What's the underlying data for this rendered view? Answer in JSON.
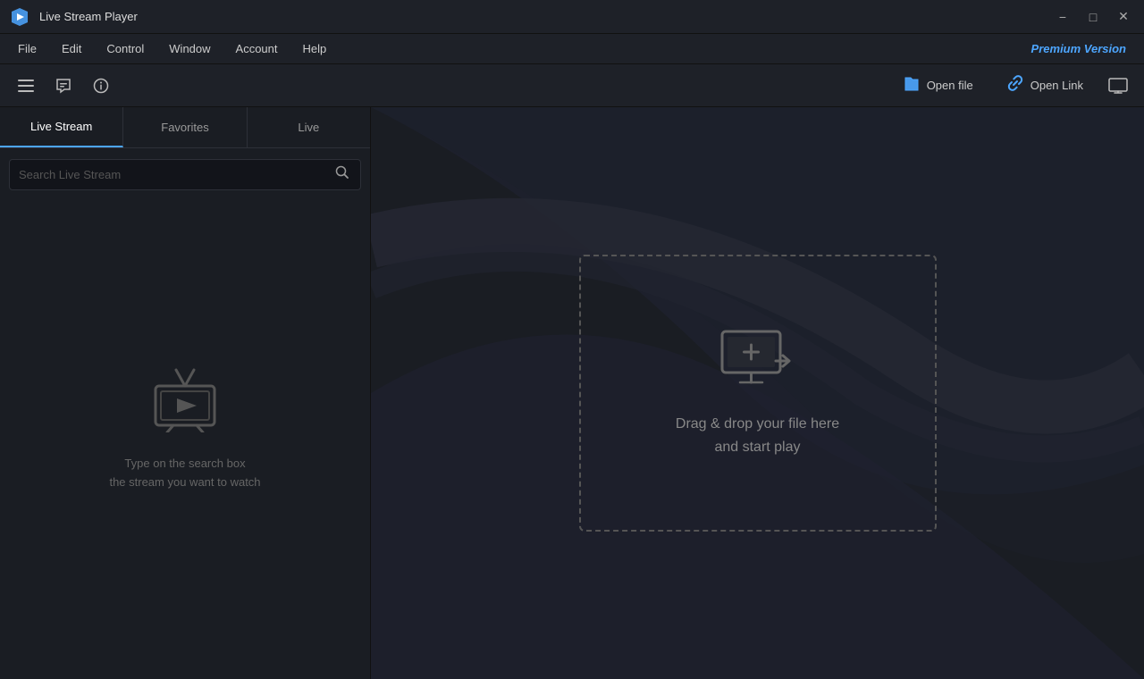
{
  "titlebar": {
    "title": "Live Stream Player",
    "minimize_label": "−",
    "maximize_label": "□",
    "close_label": "✕"
  },
  "menubar": {
    "items": [
      {
        "id": "file",
        "label": "File"
      },
      {
        "id": "edit",
        "label": "Edit"
      },
      {
        "id": "control",
        "label": "Control"
      },
      {
        "id": "window",
        "label": "Window"
      },
      {
        "id": "account",
        "label": "Account"
      },
      {
        "id": "help",
        "label": "Help"
      }
    ],
    "premium_label": "Premium Version"
  },
  "toolbar": {
    "open_file_label": "Open file",
    "open_link_label": "Open Link"
  },
  "sidebar": {
    "tabs": [
      {
        "id": "live-stream",
        "label": "Live Stream",
        "active": true
      },
      {
        "id": "favorites",
        "label": "Favorites",
        "active": false
      },
      {
        "id": "live",
        "label": "Live",
        "active": false
      }
    ],
    "search_placeholder": "Search Live Stream",
    "empty_line1": "Type on the search box",
    "empty_line2": "the stream you want to watch"
  },
  "dropzone": {
    "line1": "Drag & drop your file here",
    "line2": "and start play"
  }
}
